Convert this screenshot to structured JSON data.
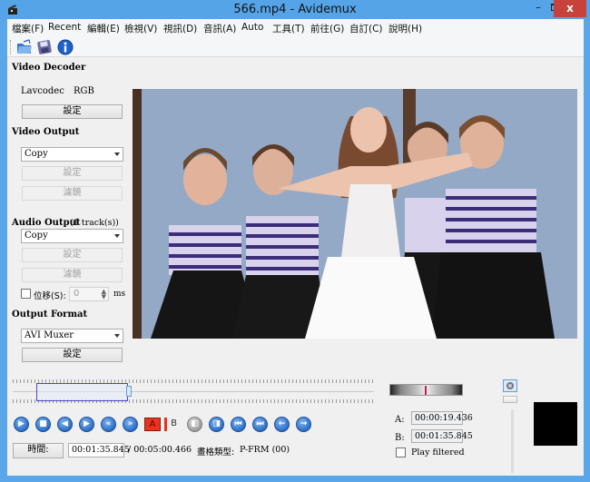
{
  "window": {
    "title": "566.mp4 - Avidemux",
    "minimize_label": "–",
    "close_label": "x"
  },
  "menu": [
    {
      "label": "檔案(F)"
    },
    {
      "label": "Recent"
    },
    {
      "label": "編輯(E)"
    },
    {
      "label": "檢視(V)"
    },
    {
      "label": "視訊(D)"
    },
    {
      "label": "音訊(A)"
    },
    {
      "label": "Auto"
    },
    {
      "label": "工具(T)"
    },
    {
      "label": "前往(G)"
    },
    {
      "label": "自訂(C)"
    },
    {
      "label": "說明(H)"
    }
  ],
  "toolbar": {
    "icons": [
      "open-folder-icon",
      "save-disk-icon",
      "info-icon"
    ]
  },
  "left_panel": {
    "video_decoder": {
      "title": "Video Decoder",
      "decoder": "Lavcodec",
      "colorspace": "RGB",
      "settings_label": "設定"
    },
    "video_output": {
      "title": "Video Output",
      "codec": "Copy",
      "settings_label": "設定",
      "filters_label": "濾鏡"
    },
    "audio_output": {
      "title": "Audio Output",
      "tracks": "(1 track(s))",
      "codec": "Copy",
      "settings_label": "設定",
      "filters_label": "濾鏡",
      "shift_label": "位移(S):",
      "shift_value": "0",
      "shift_unit": "ms",
      "shift_checked": false
    },
    "output_format": {
      "title": "Output Format",
      "muxer": "AVI Muxer",
      "settings_label": "設定"
    }
  },
  "timeline": {
    "position_fraction": 0.319,
    "marker_a_fraction": 0.065,
    "marker_b_fraction": 0.319
  },
  "transport": {
    "buttons": [
      {
        "name": "play-button",
        "glyph": "▶"
      },
      {
        "name": "stop-button",
        "glyph": "■"
      },
      {
        "name": "prev-frame-button",
        "glyph": "◀"
      },
      {
        "name": "next-frame-button",
        "glyph": "▶"
      },
      {
        "name": "prev-keyframe-button",
        "glyph": "«"
      },
      {
        "name": "next-keyframe-button",
        "glyph": "»"
      },
      {
        "name": "set-marker-a-button",
        "glyph": "A"
      },
      {
        "name": "set-marker-b-button",
        "glyph": "B"
      },
      {
        "name": "prev-black-frame-button",
        "glyph": "◧"
      },
      {
        "name": "next-black-frame-button",
        "glyph": "◨"
      },
      {
        "name": "goto-first-frame-button",
        "glyph": "⏮"
      },
      {
        "name": "goto-last-frame-button",
        "glyph": "⏭"
      },
      {
        "name": "back-60s-button",
        "glyph": "←"
      },
      {
        "name": "forward-60s-button",
        "glyph": "→"
      }
    ]
  },
  "status": {
    "time_button_label": "時間:",
    "current_time": "00:01:35.845",
    "total_time": "/ 00:05:00.466",
    "frame_type_label": "畫格類型:",
    "frame_type_value": "P-FRM (00)"
  },
  "selection": {
    "a_label": "A:",
    "a_value": "00:00:19.436",
    "b_label": "B:",
    "b_value": "00:01:35.845",
    "play_filtered_label": "Play filtered",
    "play_filtered_checked": false
  },
  "colors": {
    "title_bar": "#56a4e8",
    "close_button": "#c7423b",
    "selection_border": "#4a47c9",
    "shuttle_needle": "#c0205a"
  }
}
